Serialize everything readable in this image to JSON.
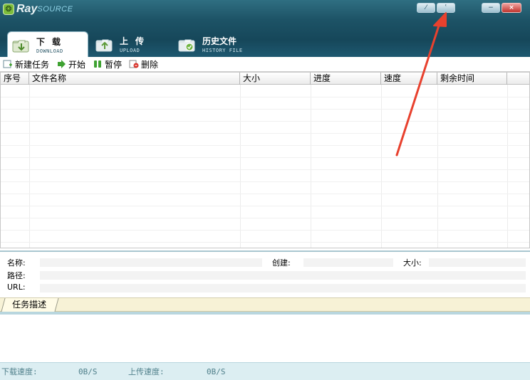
{
  "app": {
    "logo_ray": "Ray",
    "logo_source": "SOURCE"
  },
  "window_buttons": {
    "btn1": "⁄",
    "btn2": "ʿ",
    "minimize": "−",
    "close": "×"
  },
  "tabs": [
    {
      "zh": "下载",
      "en": "DOWNLOAD",
      "active": true
    },
    {
      "zh": "上传",
      "en": "UPLOAD",
      "active": false
    },
    {
      "zh": "历史文件",
      "en": "HISTORY FILE",
      "active": false
    }
  ],
  "toolbar": {
    "new_task": "新建任务",
    "start": "开始",
    "pause": "暂停",
    "delete": "删除"
  },
  "table": {
    "columns": [
      "序号",
      "文件名称",
      "大小",
      "进度",
      "速度",
      "剩余时间"
    ]
  },
  "detail": {
    "name_label": "名称:",
    "created_label": "创建:",
    "size_label": "大小:",
    "path_label": "路径:",
    "url_label": "URL:"
  },
  "desc_tab": "任务描述",
  "status": {
    "download_label": "下载速度:",
    "download_value": "0B/S",
    "upload_label": "上传速度:",
    "upload_value": "0B/S"
  },
  "colors": {
    "header": "#1d5366",
    "annotation": "#e8412e",
    "status_bg": "#dceef2"
  }
}
